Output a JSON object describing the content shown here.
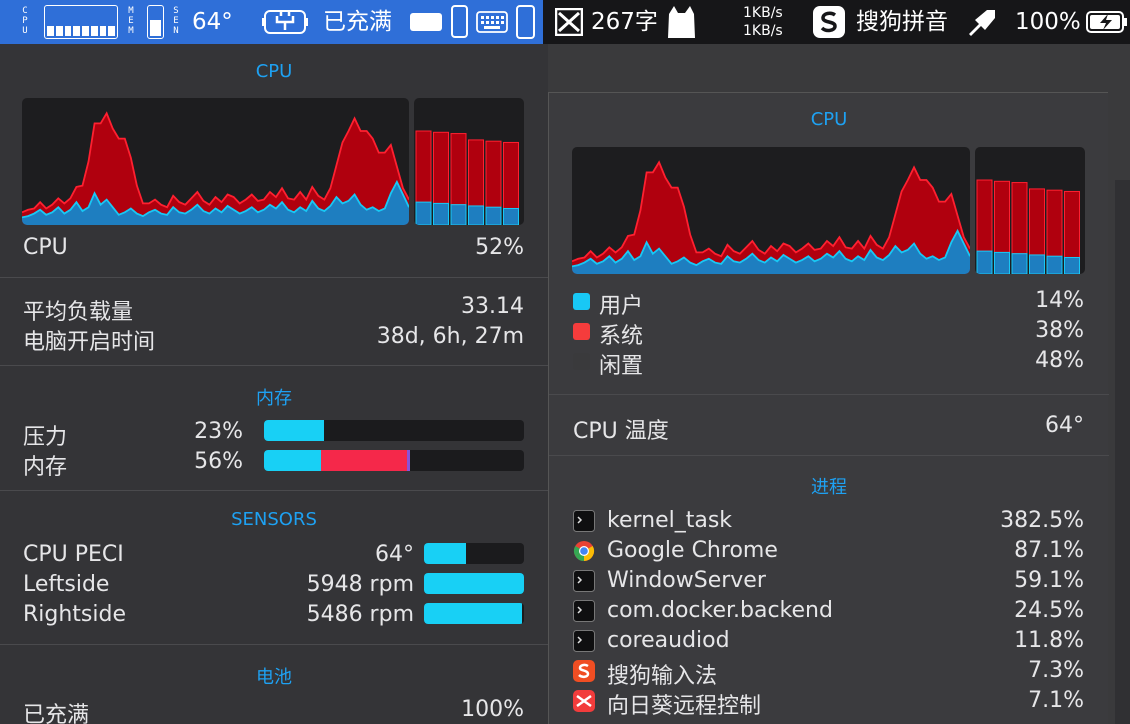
{
  "menubar": {
    "cpu_vertical": "CPU",
    "mem_vertical": "MEM",
    "sen_vertical": "SEN",
    "temp": "64°",
    "charge_status": "已充满",
    "word_count": "267字",
    "net_up": "1KB/s",
    "net_down": "1KB/s",
    "ime_name": "搜狗拼音",
    "battery_percent": "100%",
    "cpu_mini_levels": [
      0.35,
      0.35,
      0.35,
      0.35,
      0.35,
      0.35,
      0.35,
      0.35
    ],
    "mem_mini_level": 0.56,
    "colors": {
      "highlight": "#2f6fd8",
      "bar": "#161618"
    }
  },
  "left": {
    "cpu_title": "CPU",
    "cpu_label": "CPU",
    "cpu_value": "52%",
    "load_label": "平均负载量",
    "load_value": "33.14",
    "uptime_label": "电脑开启时间",
    "uptime_value": "38d, 6h, 27m",
    "memory_title": "内存",
    "pressure_label": "压力",
    "pressure_value": "23%",
    "pressure_fill": 0.23,
    "memory_label": "内存",
    "memory_value": "56%",
    "memory_fill_segments": [
      {
        "color": "#18d0f5",
        "fraction": 0.22
      },
      {
        "color": "#f5284a",
        "fraction": 0.33
      },
      {
        "color": "#8a52d8",
        "fraction": 0.01
      }
    ],
    "sensors_title": "SENSORS",
    "sensors": [
      {
        "label": "CPU PECI",
        "value": "64°",
        "fill": 0.42
      },
      {
        "label": "Leftside",
        "value": "5948 rpm",
        "fill": 1.0
      },
      {
        "label": "Rightside",
        "value": "5486 rpm",
        "fill": 0.98
      }
    ],
    "battery_title": "电池",
    "battery_label": "已充满",
    "battery_value": "100%"
  },
  "right": {
    "cpu_title": "CPU",
    "legend": [
      {
        "label": "用户",
        "value": "14%",
        "color": "#18c8f5"
      },
      {
        "label": "系统",
        "value": "38%",
        "color": "#f53c3c"
      },
      {
        "label": "闲置",
        "value": "48%",
        "color": "#3a3a3c"
      }
    ],
    "temp_label": "CPU 温度",
    "temp_value": "64°",
    "process_title": "进程",
    "processes": [
      {
        "name": "kernel_task",
        "value": "382.5%",
        "icon": "terminal-icon"
      },
      {
        "name": "Google Chrome",
        "value": "87.1%",
        "icon": "chrome-icon"
      },
      {
        "name": "WindowServer",
        "value": "59.1%",
        "icon": "terminal-icon"
      },
      {
        "name": "com.docker.backend",
        "value": "24.5%",
        "icon": "terminal-icon"
      },
      {
        "name": "coreaudiod",
        "value": "11.8%",
        "icon": "terminal-icon"
      },
      {
        "name": "搜狗输入法",
        "value": "7.3%",
        "icon": "sogou-icon"
      },
      {
        "name": "向日葵远程控制",
        "value": "7.1%",
        "icon": "sunflower-icon"
      }
    ]
  },
  "chart_data": {
    "type": "area",
    "series": [
      {
        "name": "用户",
        "color": "#18c8f5",
        "values": [
          6,
          7,
          9,
          12,
          8,
          10,
          14,
          9,
          12,
          18,
          11,
          14,
          25,
          16,
          20,
          14,
          8,
          10,
          13,
          9,
          7,
          10,
          12,
          9,
          8,
          14,
          10,
          9,
          12,
          16,
          11,
          9,
          13,
          10,
          15,
          12,
          9,
          11,
          14,
          10,
          12,
          16,
          13,
          18,
          12,
          10,
          14,
          11,
          19,
          13,
          11,
          15,
          22,
          17,
          19,
          24,
          16,
          12,
          14,
          11,
          13,
          25,
          34,
          24,
          14
        ]
      },
      {
        "name": "系统",
        "color": "#b0000e",
        "values": [
          4,
          5,
          4,
          6,
          5,
          6,
          7,
          8,
          9,
          12,
          20,
          36,
          55,
          64,
          68,
          62,
          60,
          58,
          40,
          22,
          10,
          7,
          8,
          7,
          6,
          9,
          8,
          7,
          9,
          10,
          8,
          7,
          9,
          8,
          9,
          10,
          8,
          9,
          10,
          9,
          8,
          10,
          9,
          11,
          9,
          10,
          12,
          9,
          11,
          10,
          9,
          14,
          25,
          48,
          55,
          60,
          58,
          62,
          54,
          46,
          44,
          38,
          12,
          5,
          6
        ]
      }
    ],
    "bars": [
      {
        "user": 18,
        "system": 56
      },
      {
        "user": 17,
        "system": 56
      },
      {
        "user": 16,
        "system": 56
      },
      {
        "user": 15,
        "system": 52
      },
      {
        "user": 14,
        "system": 52
      },
      {
        "user": 13,
        "system": 52
      }
    ],
    "ylim": [
      0,
      100
    ]
  }
}
